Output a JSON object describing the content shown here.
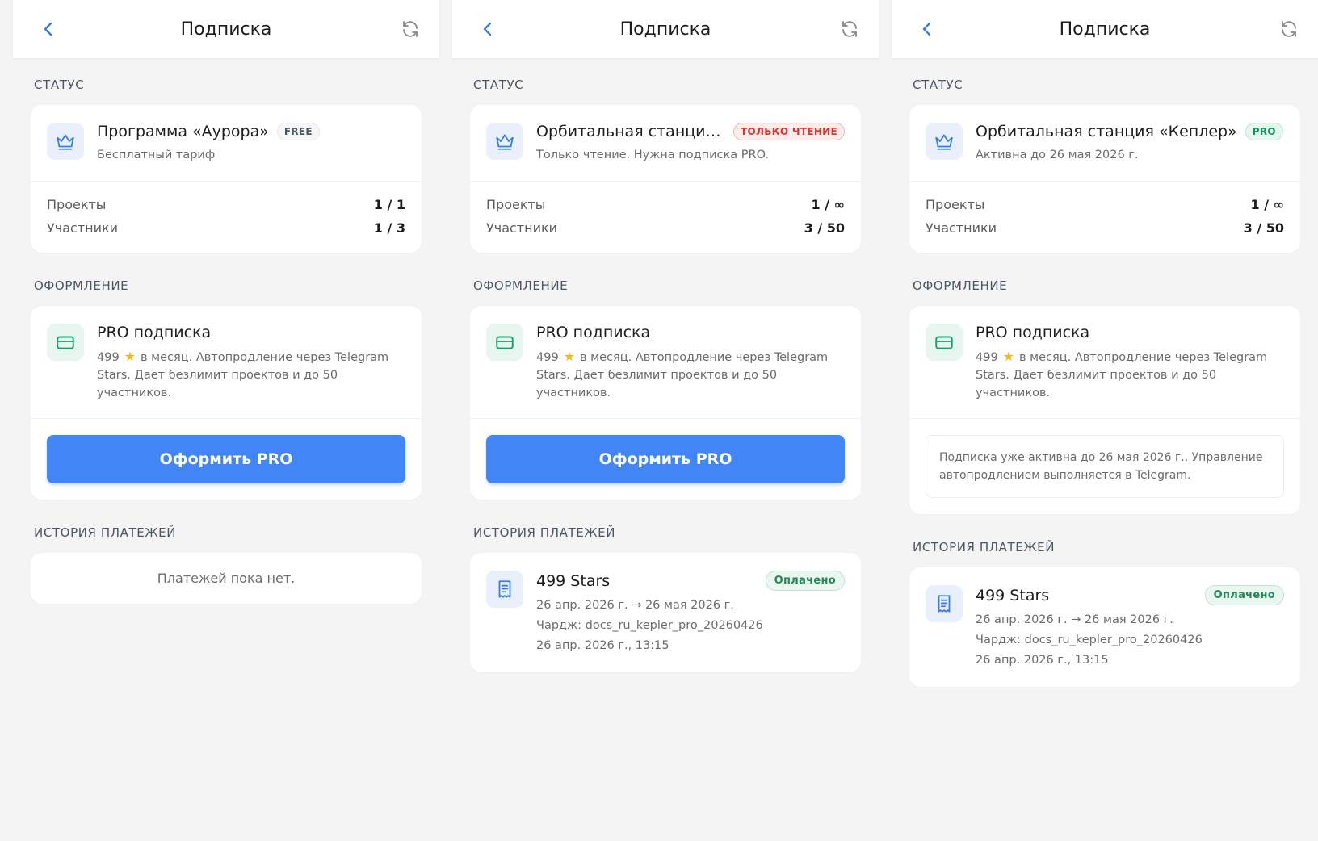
{
  "screens": [
    {
      "header_title": "Подписка",
      "status_label": "СТАТУС",
      "status": {
        "title": "Программа «Аурора»",
        "badge": "FREE",
        "subtitle": "Бесплатный тариф",
        "projects_label": "Проекты",
        "projects_value": "1 / 1",
        "members_label": "Участники",
        "members_value": "1 / 3"
      },
      "checkout_label": "ОФОРМЛЕНИЕ",
      "plan": {
        "title": "PRO подписка",
        "price": "499",
        "desc_rest": "в месяц. Автопродление через Telegram Stars. Дает безлимит проектов и до 50 участников."
      },
      "button": "Оформить PRO",
      "history_label": "ИСТОРИЯ ПЛАТЕЖЕЙ",
      "history_empty": "Платежей пока нет."
    },
    {
      "header_title": "Подписка",
      "status_label": "СТАТУС",
      "status": {
        "title": "Орбитальная станция…",
        "badge": "ТОЛЬКО ЧТЕНИЕ",
        "subtitle": "Только чтение. Нужна подписка PRO.",
        "projects_label": "Проекты",
        "projects_value": "1 / ∞",
        "members_label": "Участники",
        "members_value": "3 / 50"
      },
      "checkout_label": "ОФОРМЛЕНИЕ",
      "plan": {
        "title": "PRO подписка",
        "price": "499",
        "desc_rest": "в месяц. Автопродление через Telegram Stars. Дает безлимит проектов и до 50 участников."
      },
      "button": "Оформить PRO",
      "history_label": "ИСТОРИЯ ПЛАТЕЖЕЙ",
      "payment": {
        "amount": "499 Stars",
        "status": "Оплачено",
        "period": "26 апр. 2026 г. → 26 мая 2026 г.",
        "charge": "Чардж: docs_ru_kepler_pro_20260426",
        "date": "26 апр. 2026 г., 13:15"
      }
    },
    {
      "header_title": "Подписка",
      "status_label": "СТАТУС",
      "status": {
        "title": "Орбитальная станция «Кеплер»",
        "badge": "PRO",
        "subtitle": "Активна до 26 мая 2026 г.",
        "projects_label": "Проекты",
        "projects_value": "1 / ∞",
        "members_label": "Участники",
        "members_value": "3 / 50"
      },
      "checkout_label": "ОФОРМЛЕНИЕ",
      "plan": {
        "title": "PRO подписка",
        "price": "499",
        "desc_rest": "в месяц. Автопродление через Telegram Stars. Дает безлимит проектов и до 50 участников."
      },
      "note": "Подписка уже активна до 26 мая 2026 г.. Управление автопродлением выполняется в Telegram.",
      "history_label": "ИСТОРИЯ ПЛАТЕЖЕЙ",
      "payment": {
        "amount": "499 Stars",
        "status": "Оплачено",
        "period": "26 апр. 2026 г. → 26 мая 2026 г.",
        "charge": "Чардж: docs_ru_kepler_pro_20260426",
        "date": "26 апр. 2026 г., 13:15"
      }
    }
  ],
  "colors": {
    "accent": "#4285f4",
    "background": "#f4f4f5",
    "free_badge": "#4b5563",
    "readonly_badge": "#d9362b",
    "pro_badge": "#15935d",
    "star": "#f1b81f"
  },
  "icons": {
    "back": "chevron-left-icon",
    "refresh": "refresh-icon",
    "status": "crown-icon",
    "plan": "credit-card-icon",
    "payment": "receipt-icon",
    "price_unit": "star-icon"
  }
}
